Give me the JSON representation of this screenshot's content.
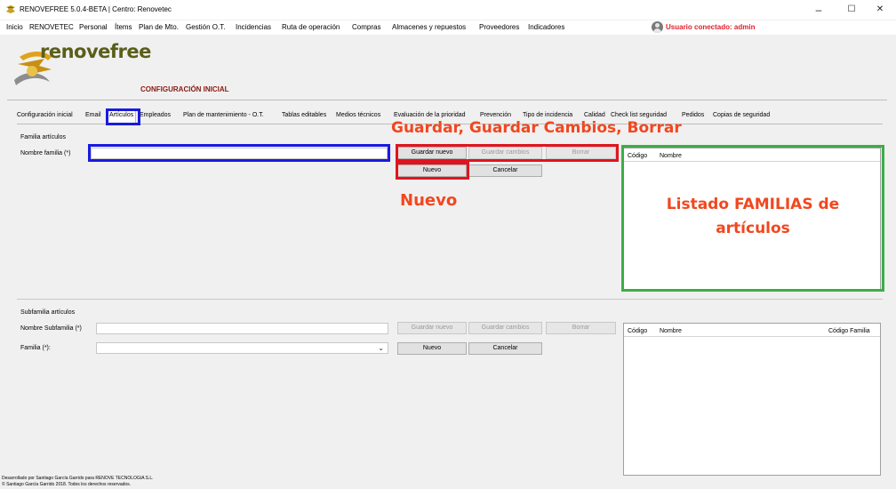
{
  "window": {
    "title": "RENOVEFREE 5.0.4-BETA | Centro: Renovetec",
    "controls": {
      "minimize": "–",
      "maximize": "☐",
      "close": "✕"
    }
  },
  "menu": {
    "items": [
      "Inicio",
      "RENOVETEC",
      "Personal",
      "Ítems",
      "Plan de Mto.",
      "Gestión O.T.",
      "Incidencias",
      "Ruta de operación",
      "Compras",
      "Almacenes y repuestos",
      "Proveedores",
      "Indicadores"
    ],
    "user_label": "Usuario conectado: admin"
  },
  "header": {
    "logo_text": "renovefree",
    "section_title": "CONFIGURACIÓN INICIAL"
  },
  "tabs": [
    "Configuración inicial",
    "Email",
    "Artículos",
    "Empleados",
    "Plan de mantenimiento - O.T.",
    "Tablas editables",
    "Medios técnicos",
    "Evaluación de la prioridad",
    "Prevención",
    "Tipo de incidencia",
    "Calidad",
    "Check list seguridad",
    "Pedidos",
    "Copias de seguridad"
  ],
  "familia": {
    "group_title": "Familia artículos",
    "name_label": "Nombre familia (*)",
    "name_value": "",
    "btn_guardar_nuevo": "Guardar nuevo",
    "btn_guardar_cambios": "Guardar cambios",
    "btn_borrar": "Borrar",
    "btn_nuevo": "Nuevo",
    "btn_cancelar": "Cancelar",
    "list_headers": [
      "Código",
      "Nombre"
    ]
  },
  "subfamilia": {
    "group_title": "Subfamilia artículos",
    "name_label": "Nombre Subfamilia (*)",
    "name_value": "",
    "familia_label": "Familia (*):",
    "familia_value": "",
    "btn_guardar_nuevo": "Guardar nuevo",
    "btn_guardar_cambios": "Guardar cambios",
    "btn_borrar": "Borrar",
    "btn_nuevo": "Nuevo",
    "btn_cancelar": "Cancelar",
    "list_headers": [
      "Código",
      "Nombre",
      "Código Familia"
    ]
  },
  "annotations": {
    "guardar": "Guardar, Guardar Cambios, Borrar",
    "nuevo": "Nuevo",
    "listado_line1": "Listado FAMILIAS de",
    "listado_line2": "artículos"
  },
  "footer": {
    "line1": "Desarrollado por Santiago García Garrido para RENOVE TECNOLOGIA S.L.",
    "line2": "© Santiago García Garrido 2018. Todos los derechos reservados."
  },
  "colors": {
    "annotation_blue": "#1a1ae0",
    "annotation_red": "#e0141e",
    "annotation_green": "#3cae45",
    "annotation_text": "#f2471f",
    "user_label": "#e01f2c"
  }
}
